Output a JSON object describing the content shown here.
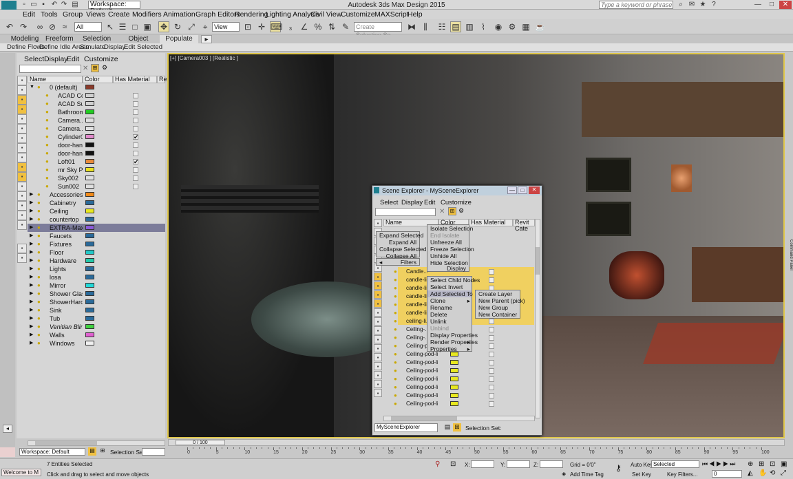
{
  "app": {
    "title": "Autodesk 3ds Max Design 2015",
    "logo_label": "MXD",
    "workspace": "Workspace: Default",
    "search_placeholder": "Type a keyword or phrase"
  },
  "menu": [
    "Edit",
    "Tools",
    "Group",
    "Views",
    "Create",
    "Modifiers",
    "Animation",
    "Graph Editors",
    "Rendering",
    "Lighting Analysis",
    "Civil View",
    "Customize",
    "MAXScript",
    "Help"
  ],
  "toolbar": {
    "selection_filter": "All",
    "ref_coord": "View",
    "named_selection": "Create Selection Se"
  },
  "ribbon": {
    "tabs": [
      "Modeling",
      "Freeform",
      "Selection",
      "Object Paint",
      "Populate"
    ],
    "active_tab": "Populate",
    "sub_items": [
      "Define Flows",
      "Define Idle Areas",
      "Simulate",
      "Display",
      "Edit Selected"
    ]
  },
  "left_explorer": {
    "menu": [
      "Select",
      "Display",
      "Edit",
      "Customize"
    ],
    "columns": [
      "Name",
      "Color",
      "Has Material",
      "Re"
    ],
    "rows": [
      {
        "name": "0 (default)",
        "color": "#8a3a2a",
        "check": "",
        "level": 0,
        "expand": "down"
      },
      {
        "name": "ACAD Co...",
        "color": "#d0d0d0",
        "check": "",
        "level": 1
      },
      {
        "name": "ACAD Sun",
        "color": "#d0d0d0",
        "check": "",
        "level": 1
      },
      {
        "name": "Bathroom...",
        "color": "#22cc22",
        "check": "",
        "level": 1
      },
      {
        "name": "Camera...",
        "color": "#e0e0e0",
        "check": "",
        "level": 1
      },
      {
        "name": "Camera...",
        "color": "#e0e0e0",
        "check": "",
        "level": 1
      },
      {
        "name": "Cylinder01",
        "color": "#e08aca",
        "check": "✔",
        "level": 1
      },
      {
        "name": "door-handle",
        "color": "#111111",
        "check": "",
        "level": 1
      },
      {
        "name": "door-handle",
        "color": "#111111",
        "check": "",
        "level": 1
      },
      {
        "name": "Loft01",
        "color": "#e88a3a",
        "check": "✔",
        "level": 1
      },
      {
        "name": "mr Sky P...",
        "color": "#e8e020",
        "check": "",
        "level": 1
      },
      {
        "name": "Sky002",
        "color": "#e0e0e0",
        "check": "",
        "level": 1
      },
      {
        "name": "Sun002",
        "color": "#e0e0e0",
        "check": "",
        "level": 1
      },
      {
        "name": "Accessories",
        "color": "#f08a1a",
        "check": "",
        "level": 0,
        "expand": "right"
      },
      {
        "name": "Cabinetry",
        "color": "#2a6a9a",
        "check": "",
        "level": 0,
        "expand": "right"
      },
      {
        "name": "Ceiling",
        "color": "#e8e820",
        "check": "",
        "level": 0,
        "expand": "right"
      },
      {
        "name": "countertop",
        "color": "#2a6a9a",
        "check": "",
        "level": 0,
        "expand": "right"
      },
      {
        "name": "EXTRA-Max-...",
        "color": "#8a5ad8",
        "check": "",
        "level": 0,
        "expand": "right",
        "selected": true
      },
      {
        "name": "Faucets",
        "color": "#2a6a9a",
        "check": "",
        "level": 0,
        "expand": "right"
      },
      {
        "name": "Fixtures",
        "color": "#2a6a9a",
        "check": "",
        "level": 0,
        "expand": "right"
      },
      {
        "name": "Floor",
        "color": "#22c8c8",
        "check": "",
        "level": 0,
        "expand": "right"
      },
      {
        "name": "Hardware",
        "color": "#22c8a8",
        "check": "",
        "level": 0,
        "expand": "right"
      },
      {
        "name": "Lights",
        "color": "#2a6a9a",
        "check": "",
        "level": 0,
        "expand": "right"
      },
      {
        "name": "losa",
        "color": "#2a6a9a",
        "check": "",
        "level": 0,
        "expand": "right"
      },
      {
        "name": "Mirror",
        "color": "#22d8d8",
        "check": "",
        "level": 0,
        "expand": "right"
      },
      {
        "name": "Shower Glass",
        "color": "#2a6a9a",
        "check": "",
        "level": 0,
        "expand": "right"
      },
      {
        "name": "ShowerHard...",
        "color": "#2a6a9a",
        "check": "",
        "level": 0,
        "expand": "right"
      },
      {
        "name": "Sink",
        "color": "#2a6a9a",
        "check": "",
        "level": 0,
        "expand": "right"
      },
      {
        "name": "Tub",
        "color": "#2a6a9a",
        "check": "",
        "level": 0,
        "expand": "right"
      },
      {
        "name": "Venitian Blinds",
        "color": "#40d040",
        "check": "",
        "level": 0,
        "expand": "right"
      },
      {
        "name": "Walls",
        "color": "#e060d0",
        "check": "",
        "level": 0,
        "expand": "right"
      },
      {
        "name": "Windows",
        "color": "#f0f0f0",
        "check": "",
        "level": 0,
        "expand": "right"
      }
    ]
  },
  "viewport": {
    "label": "[+] [Camera003 ] [Realistic ]"
  },
  "scene_explorer": {
    "title": "Scene Explorer - MySceneExplorer",
    "menu": [
      "Select",
      "Display",
      "Edit",
      "Customize"
    ],
    "columns": [
      "Name",
      "Color",
      "Has Material",
      "Revit Cate"
    ],
    "visible_rows": [
      "Candle...",
      "candle-li...",
      "candle-li...",
      "candle-li...",
      "candle-li...",
      "candle-li...",
      "ceiling-li...",
      "Ceiling-...",
      "Ceiling-...",
      "Ceiling-pod-li...",
      "Ceiling-pod-li...",
      "Ceiling-pod-li...",
      "Ceiling-pod-li...",
      "Ceiling-pod-li...",
      "Ceiling-pod-li...",
      "Ceiling-pod-li...",
      "Ceiling-pod-li..."
    ],
    "explorer_name": "MySceneExplorer",
    "selection_set_label": "Selection Set:",
    "ctx_left": [
      "Expand Selected",
      "Expand All",
      "Collapse Selected",
      "Collapse All"
    ],
    "ctx_filters": "Filters",
    "ctx_main": [
      "Isolate Selection",
      "End Isolate",
      "Unfreeze All",
      "Freeze Selection",
      "Unhide All",
      "Hide Selection"
    ],
    "ctx_display": "Display",
    "ctx_edit": [
      "Select Child Nodes",
      "Select Invert",
      "Add Selected To",
      "Clone",
      "Rename",
      "Delete",
      "Unlink",
      "Unbind",
      "Display Properties",
      "Render Properties",
      "Properties"
    ],
    "ctx_sub": [
      "Create Layer",
      "New Parent (pick)",
      "New Group",
      "New Container"
    ],
    "side_label": "Command Panel"
  },
  "timeline": {
    "frame": "0 / 100",
    "ticks": [
      "0",
      "5",
      "10",
      "15",
      "20",
      "25",
      "30",
      "35",
      "40",
      "45",
      "50",
      "55",
      "60",
      "65",
      "70",
      "75",
      "80",
      "85",
      "90",
      "95",
      "100"
    ]
  },
  "status": {
    "workspace": "Workspace: Default",
    "selection_set": "Selection Set:",
    "welcome": "Welcome to M",
    "entities": "7 Entities Selected",
    "prompt": "Click and drag to select and move objects",
    "x_label": "X:",
    "y_label": "Y:",
    "z_label": "Z:",
    "grid": "Grid = 0'0\"",
    "add_time_tag": "Add Time Tag",
    "auto_key": "Auto Key",
    "set_key": "Set Key",
    "selected": "Selected",
    "key_filters": "Key Filters...",
    "frame_value": "0"
  }
}
